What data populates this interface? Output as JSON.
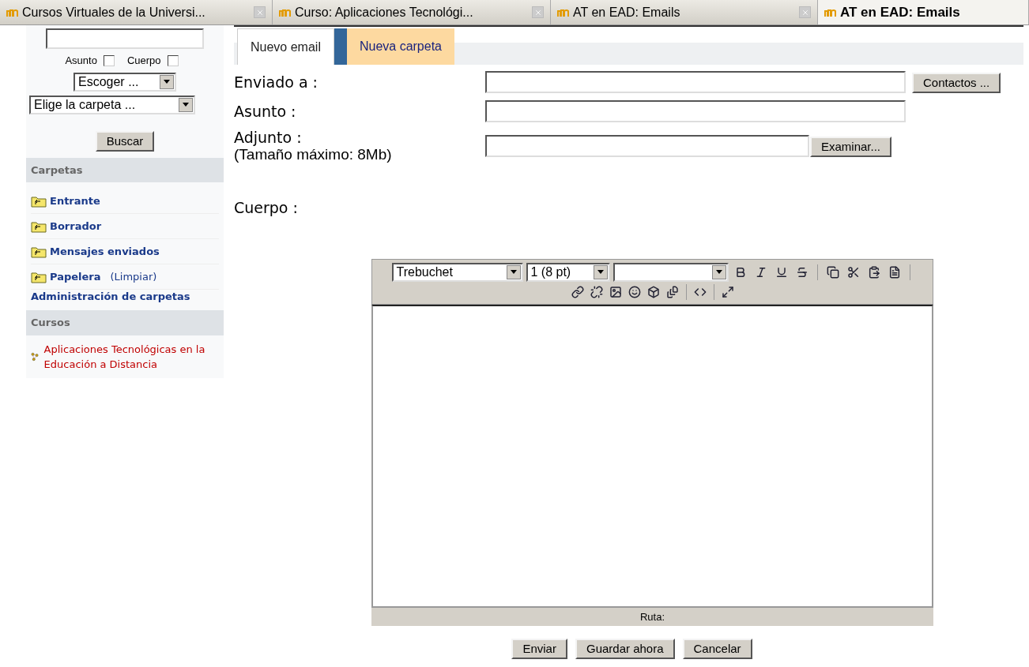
{
  "browser_tabs": [
    {
      "label": "Cursos Virtuales de la Universi...",
      "selected": false
    },
    {
      "label": "Curso: Aplicaciones Tecnológi...",
      "selected": false
    },
    {
      "label": "AT en EAD: Emails",
      "selected": false
    },
    {
      "label": "AT en EAD: Emails",
      "selected": true
    }
  ],
  "sidebar": {
    "search_checkboxes": [
      {
        "label": "Asunto",
        "checked": false
      },
      {
        "label": "Cuerpo",
        "checked": false
      }
    ],
    "select_1": "Escoger ...",
    "select_2": "Elige la carpeta ...",
    "search_button": "Buscar",
    "folders_heading": "Carpetas",
    "folders": [
      {
        "label": "Entrante"
      },
      {
        "label": "Borrador"
      },
      {
        "label": "Mensajes enviados"
      },
      {
        "label": "Papelera",
        "action": "(Limpiar)"
      }
    ],
    "admin_link": "Administración de carpetas",
    "courses_heading": "Cursos",
    "courses": [
      {
        "label": "Aplicaciones Tecnológicas en la Educación a Distancia"
      }
    ]
  },
  "tabs": [
    {
      "label": "Nuevo email",
      "selected": true
    },
    {
      "label": "Nueva carpeta",
      "selected": false
    }
  ],
  "form": {
    "to_label": "Enviado a :",
    "contacts_button": "Contactos ...",
    "subject_label": "Asunto :",
    "attach_label": "Adjunto :",
    "attach_hint": "(Tamaño máximo: 8Mb)",
    "browse_button": "Examinar...",
    "body_label": "Cuerpo :"
  },
  "editor": {
    "font": "Trebuchet",
    "size": "1 (8 pt)",
    "status": "Ruta:"
  },
  "buttons": [
    "Enviar",
    "Guardar ahora",
    "Cancelar"
  ]
}
